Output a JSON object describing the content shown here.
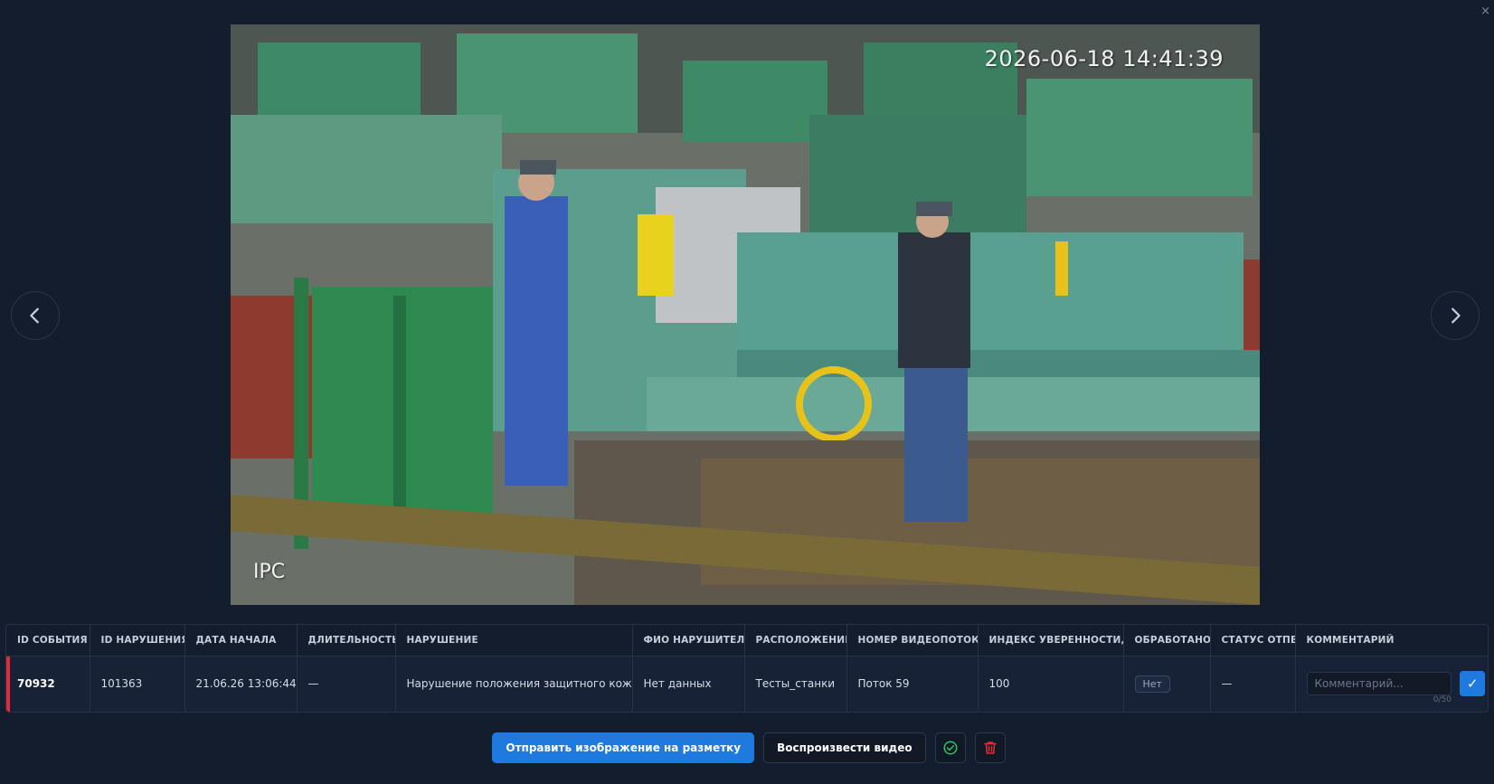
{
  "viewer": {
    "timestamp": "2026-06-18 14:41:39",
    "camera_label": "IPC"
  },
  "icons": {
    "prev": "chevron-left-icon",
    "next": "chevron-right-icon",
    "close": "close-icon",
    "approve": "check-circle-icon",
    "delete": "trash-icon",
    "submit_comment": "check-icon"
  },
  "colors": {
    "accent": "#1f7ae0",
    "row_marker": "#e02a36",
    "approve_icon": "#2ec26a",
    "delete_icon": "#e0303a"
  },
  "table": {
    "headers": [
      "ID СОБЫТИЯ",
      "ID НАРУШЕНИЯ",
      "ДАТА НАЧАЛА",
      "ДЛИТЕЛЬНОСТЬ",
      "НАРУШЕНИЕ",
      "ФИО НАРУШИТЕЛЯ",
      "РАСПОЛОЖЕНИЕ",
      "НОМЕР ВИДЕОПОТОКА",
      "ИНДЕКС УВЕРЕННОСТИ, %",
      "ОБРАБОТАНО",
      "СТАТУС ОТПБ",
      "КОММЕНТАРИЙ"
    ],
    "row": {
      "event_id": "70932",
      "violation_id": "101363",
      "start_date": "21.06.26 13:06:44",
      "duration": "—",
      "violation": "Нарушение положения защитного кожуха",
      "violator": "Нет данных",
      "location": "Тесты_станки",
      "stream": "Поток 59",
      "confidence": "100",
      "processed": "Нет",
      "otpb_status": "—",
      "comment_value": "",
      "comment_placeholder": "Комментарий...",
      "comment_counter": "0/50",
      "comment_submit": "✓"
    }
  },
  "actions": {
    "send_label": "Отправить изображение на разметку",
    "play_label": "Воспроизвести видео"
  },
  "window": {
    "close_glyph": "×"
  }
}
